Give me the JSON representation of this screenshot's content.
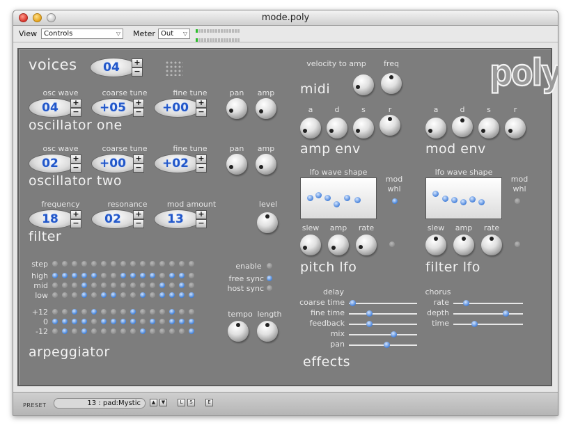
{
  "window": {
    "title": "mode.poly"
  },
  "toolbar": {
    "view_label": "View",
    "view_value": "Controls",
    "meter_label": "Meter",
    "meter_value": "Out"
  },
  "logo": "poly",
  "voices": {
    "label": "voices",
    "value": "04"
  },
  "osc_one": {
    "title": "oscillator one",
    "wave_label": "osc wave",
    "wave": "04",
    "coarse_label": "coarse tune",
    "coarse": "+05",
    "fine_label": "fine tune",
    "fine": "+00",
    "pan_label": "pan",
    "amp_label": "amp"
  },
  "osc_two": {
    "title": "oscillator two",
    "wave_label": "osc wave",
    "wave": "02",
    "coarse_label": "coarse tune",
    "coarse": "+00",
    "fine_label": "fine tune",
    "fine": "+02",
    "pan_label": "pan",
    "amp_label": "amp"
  },
  "filter": {
    "title": "filter",
    "freq_label": "frequency",
    "freq": "18",
    "res_label": "resonance",
    "res": "02",
    "mod_label": "mod amount",
    "mod": "13",
    "level_label": "level"
  },
  "arp": {
    "title": "arpeggiator",
    "step_label": "step",
    "high_label": "high",
    "mid_label": "mid",
    "low_label": "low",
    "p12_label": "+12",
    "zero_label": "0",
    "m12_label": "-12",
    "enable_label": "enable",
    "free_sync_label": "free sync",
    "host_sync_label": "host sync",
    "tempo_label": "tempo",
    "length_label": "length",
    "rows": {
      "high": [
        1,
        1,
        1,
        1,
        1,
        0,
        0,
        1,
        1,
        1,
        1,
        0,
        1,
        1,
        0
      ],
      "mid": [
        0,
        0,
        0,
        1,
        0,
        0,
        0,
        0,
        0,
        0,
        0,
        1,
        0,
        1,
        0
      ],
      "low": [
        0,
        0,
        0,
        1,
        0,
        1,
        1,
        0,
        0,
        1,
        0,
        1,
        1,
        1,
        1
      ],
      "p12": [
        0,
        0,
        1,
        0,
        1,
        0,
        0,
        0,
        1,
        0,
        0,
        0,
        1,
        0,
        0
      ],
      "zero": [
        1,
        1,
        1,
        1,
        0,
        1,
        1,
        1,
        1,
        0,
        1,
        0,
        1,
        1,
        1
      ],
      "m12": [
        0,
        1,
        0,
        1,
        0,
        0,
        0,
        0,
        0,
        1,
        0,
        0,
        0,
        0,
        1
      ]
    }
  },
  "midi": {
    "title": "midi",
    "vel_label": "velocity to amp",
    "freq_label": "freq"
  },
  "amp_env": {
    "title": "amp env",
    "a": "a",
    "d": "d",
    "s": "s",
    "r": "r"
  },
  "mod_env": {
    "title": "mod env",
    "a": "a",
    "d": "d",
    "s": "s",
    "r": "r"
  },
  "pitch_lfo": {
    "title": "pitch lfo",
    "wave_label": "lfo wave shape",
    "mod_label": "mod",
    "whl_label": "whl",
    "slew_label": "slew",
    "amp_label": "amp",
    "rate_label": "rate"
  },
  "filter_lfo": {
    "title": "filter lfo",
    "wave_label": "lfo wave shape",
    "mod_label": "mod",
    "whl_label": "whl",
    "slew_label": "slew",
    "amp_label": "amp",
    "rate_label": "rate"
  },
  "effects": {
    "title": "effects",
    "delay_label": "delay",
    "coarse_time_label": "coarse time",
    "coarse_time": 0.05,
    "fine_time_label": "fine time",
    "fine_time": 0.3,
    "feedback_label": "feedback",
    "feedback": 0.3,
    "mix_label": "mix",
    "mix": 0.65,
    "pan_label": "pan",
    "pan": 0.55,
    "chorus_label": "chorus",
    "rate_label": "rate",
    "rate": 0.18,
    "depth_label": "depth",
    "depth": 0.75,
    "time_label": "time",
    "time": 0.3
  },
  "footer": {
    "preset_label": "PRESET",
    "preset_value": "13 : pad:Mystic"
  }
}
